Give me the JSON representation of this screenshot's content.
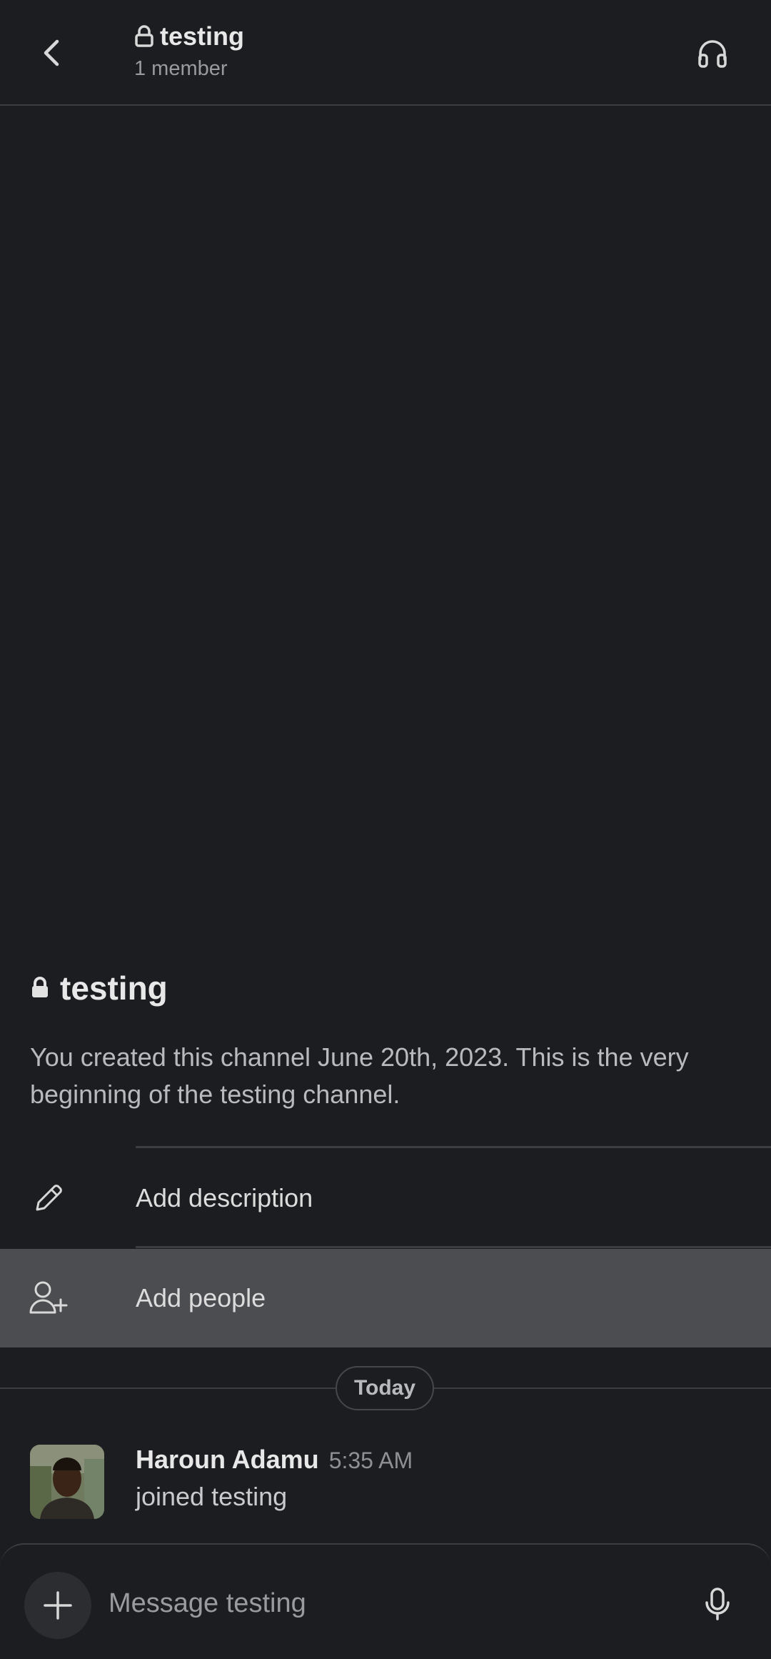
{
  "header": {
    "title": "testing",
    "subtitle": "1 member",
    "back_icon": "chevron-left-icon",
    "lock_icon": "lock-icon",
    "huddle_icon": "headphones-icon"
  },
  "intro": {
    "title": "testing",
    "description": "You created this channel June 20th, 2023. This is the very beginning of the testing channel."
  },
  "actions": [
    {
      "label": "Add description",
      "icon": "pencil-icon"
    },
    {
      "label": "Add people",
      "icon": "add-person-icon"
    }
  ],
  "divider": {
    "label": "Today"
  },
  "message": {
    "author": "Haroun Adamu",
    "time": "5:35 AM",
    "text": "joined testing"
  },
  "composer": {
    "placeholder": "Message testing",
    "plus_icon": "plus-icon",
    "mic_icon": "microphone-icon"
  },
  "colors": {
    "background": "#1b1d21",
    "highlight_row": "#4c4d51",
    "separator": "#3b3d42",
    "text_primary": "#e8e8e8",
    "text_secondary": "#9a9b9e"
  }
}
